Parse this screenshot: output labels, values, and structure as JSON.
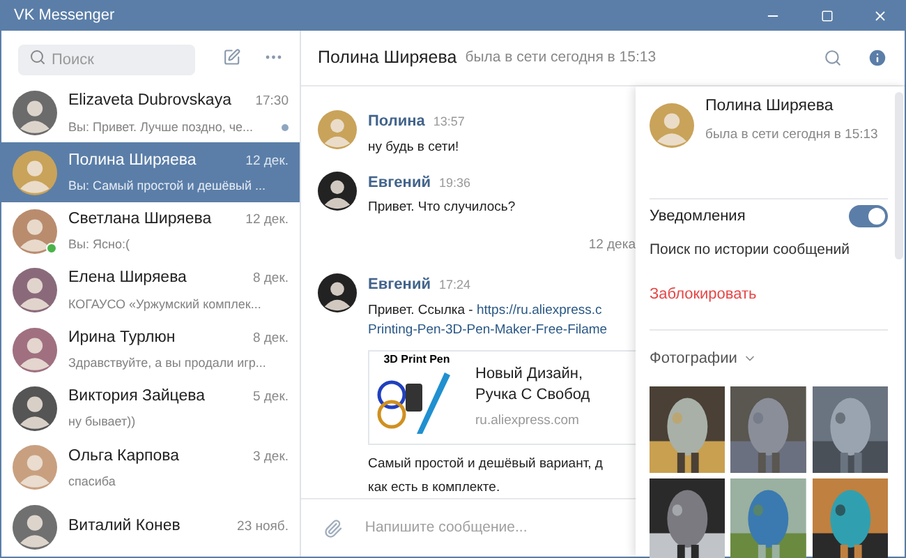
{
  "window": {
    "title": "VK Messenger"
  },
  "sidebar": {
    "search": {
      "placeholder": "Поиск"
    },
    "dialogs": [
      {
        "name": "Elizaveta Dubrovskaya",
        "time": "17:30",
        "preview": "Вы: Привет. Лучше поздно, че...",
        "selected": false,
        "unread": true,
        "online": false,
        "color": "#6b6b6b"
      },
      {
        "name": "Полина Ширяева",
        "time": "12 дек.",
        "preview": "Вы: Самый простой и дешёвый ...",
        "selected": true,
        "unread": false,
        "online": false,
        "color": "#c9a35a"
      },
      {
        "name": "Светлана Ширяева",
        "time": "12 дек.",
        "preview": "Вы: Ясно:(",
        "selected": false,
        "unread": false,
        "online": true,
        "color": "#b98c6e"
      },
      {
        "name": "Елена Ширяева",
        "time": "8 дек.",
        "preview": "КОГАУСО «Уржумский комплек...",
        "selected": false,
        "unread": false,
        "online": false,
        "color": "#8a6a7a"
      },
      {
        "name": "Ирина Турлюн",
        "time": "8 дек.",
        "preview": "Здравствуйте, а вы продали игр...",
        "selected": false,
        "unread": false,
        "online": false,
        "color": "#a07080"
      },
      {
        "name": "Виктория Зайцева",
        "time": "5 дек.",
        "preview": "ну бывает))",
        "selected": false,
        "unread": false,
        "online": false,
        "color": "#555555"
      },
      {
        "name": "Ольга Карпова",
        "time": "3 дек.",
        "preview": "спасиба",
        "selected": false,
        "unread": false,
        "online": false,
        "color": "#c8a080"
      },
      {
        "name": "Виталий Конев",
        "time": "23 нояб.",
        "selected": false,
        "unread": false,
        "online": false,
        "color": "#707070"
      }
    ]
  },
  "chat": {
    "name": "Полина Ширяева",
    "status": "была в сети сегодня в 15:13",
    "messages": [
      {
        "kind": "message",
        "author": "Полина",
        "time": "13:57",
        "lines": [
          "ну будь в сети!"
        ],
        "color": "#c9a35a"
      },
      {
        "kind": "message",
        "author": "Евгений",
        "time": "19:36",
        "lines": [
          "Привет. Что случилось?"
        ],
        "color": "#222222"
      },
      {
        "kind": "date",
        "text": "12 дека"
      },
      {
        "kind": "message",
        "author": "Евгений",
        "time": "17:24",
        "color": "#222222",
        "link_intro": "Привет. Ссылка - ",
        "link": [
          "https://ru.aliexpress.c",
          "Printing-Pen-3D-Pen-Maker-Free-Filame"
        ],
        "card": {
          "image_label": "3D Print Pen",
          "title": [
            "Новый Дизайн,",
            "Ручка С Свобод"
          ],
          "domain": "ru.aliexpress.com"
        },
        "lines": [
          "Самый простой и дешёвый вариант, д",
          "как есть в комплекте."
        ]
      }
    ],
    "composer": {
      "placeholder": "Напишите сообщение..."
    }
  },
  "info": {
    "name": "Полина Ширяева",
    "status": "была в сети сегодня в 15:13",
    "notifications": {
      "label": "Уведомления",
      "on": true
    },
    "search_history": "Поиск по истории сообщений",
    "block": "Заблокировать",
    "photos_label": "Фотографии"
  }
}
